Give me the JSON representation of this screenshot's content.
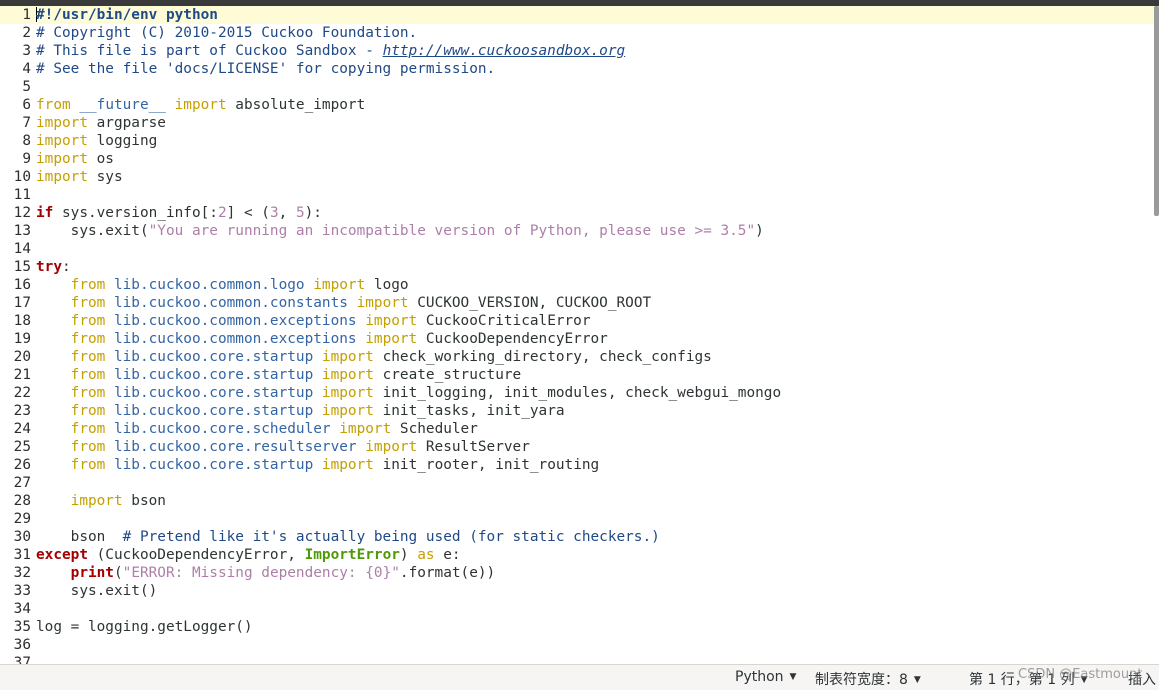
{
  "editor": {
    "lines": [
      {
        "n": "1",
        "tokens": [
          {
            "t": "#!/usr/bin/env python",
            "c": "shebang"
          }
        ]
      },
      {
        "n": "2",
        "tokens": [
          {
            "t": "# Copyright (C) 2010-2015 Cuckoo Foundation.",
            "c": "com"
          }
        ]
      },
      {
        "n": "3",
        "tokens": [
          {
            "t": "# This file is part of Cuckoo Sandbox - ",
            "c": "com"
          },
          {
            "t": "http://www.cuckoosandbox.org",
            "c": "com link"
          }
        ]
      },
      {
        "n": "4",
        "tokens": [
          {
            "t": "# See the file 'docs/LICENSE' for copying permission.",
            "c": "com"
          }
        ]
      },
      {
        "n": "5",
        "tokens": []
      },
      {
        "n": "6",
        "tokens": [
          {
            "t": "from ",
            "c": "kw"
          },
          {
            "t": "__future__",
            "c": "mod"
          },
          {
            "t": " import",
            "c": "kw"
          },
          {
            "t": " absolute_import",
            "c": ""
          }
        ]
      },
      {
        "n": "7",
        "tokens": [
          {
            "t": "import",
            "c": "kw"
          },
          {
            "t": " argparse",
            "c": ""
          }
        ]
      },
      {
        "n": "8",
        "tokens": [
          {
            "t": "import",
            "c": "kw"
          },
          {
            "t": " logging",
            "c": ""
          }
        ]
      },
      {
        "n": "9",
        "tokens": [
          {
            "t": "import",
            "c": "kw"
          },
          {
            "t": " os",
            "c": ""
          }
        ]
      },
      {
        "n": "10",
        "tokens": [
          {
            "t": "import",
            "c": "kw"
          },
          {
            "t": " sys",
            "c": ""
          }
        ]
      },
      {
        "n": "11",
        "tokens": []
      },
      {
        "n": "12",
        "tokens": [
          {
            "t": "if",
            "c": "kwb"
          },
          {
            "t": " sys.version_info[:",
            "c": ""
          },
          {
            "t": "2",
            "c": "num"
          },
          {
            "t": "] < (",
            "c": ""
          },
          {
            "t": "3",
            "c": "num"
          },
          {
            "t": ", ",
            "c": ""
          },
          {
            "t": "5",
            "c": "num"
          },
          {
            "t": "):",
            "c": ""
          }
        ]
      },
      {
        "n": "13",
        "tokens": [
          {
            "t": "    sys.exit(",
            "c": ""
          },
          {
            "t": "\"You are running an incompatible version of Python, please use >= 3.5\"",
            "c": "str"
          },
          {
            "t": ")",
            "c": ""
          }
        ]
      },
      {
        "n": "14",
        "tokens": []
      },
      {
        "n": "15",
        "tokens": [
          {
            "t": "try",
            "c": "kwb"
          },
          {
            "t": ":",
            "c": ""
          }
        ]
      },
      {
        "n": "16",
        "tokens": [
          {
            "t": "    from ",
            "c": "kw"
          },
          {
            "t": "lib.cuckoo.common.logo",
            "c": "mod"
          },
          {
            "t": " import",
            "c": "kw"
          },
          {
            "t": " logo",
            "c": ""
          }
        ]
      },
      {
        "n": "17",
        "tokens": [
          {
            "t": "    from ",
            "c": "kw"
          },
          {
            "t": "lib.cuckoo.common.constants",
            "c": "mod"
          },
          {
            "t": " import",
            "c": "kw"
          },
          {
            "t": " CUCKOO_VERSION, CUCKOO_ROOT",
            "c": ""
          }
        ]
      },
      {
        "n": "18",
        "tokens": [
          {
            "t": "    from ",
            "c": "kw"
          },
          {
            "t": "lib.cuckoo.common.exceptions",
            "c": "mod"
          },
          {
            "t": " import",
            "c": "kw"
          },
          {
            "t": " CuckooCriticalError",
            "c": ""
          }
        ]
      },
      {
        "n": "19",
        "tokens": [
          {
            "t": "    from ",
            "c": "kw"
          },
          {
            "t": "lib.cuckoo.common.exceptions",
            "c": "mod"
          },
          {
            "t": " import",
            "c": "kw"
          },
          {
            "t": " CuckooDependencyError",
            "c": ""
          }
        ]
      },
      {
        "n": "20",
        "tokens": [
          {
            "t": "    from ",
            "c": "kw"
          },
          {
            "t": "lib.cuckoo.core.startup",
            "c": "mod"
          },
          {
            "t": " import",
            "c": "kw"
          },
          {
            "t": " check_working_directory, check_configs",
            "c": ""
          }
        ]
      },
      {
        "n": "21",
        "tokens": [
          {
            "t": "    from ",
            "c": "kw"
          },
          {
            "t": "lib.cuckoo.core.startup",
            "c": "mod"
          },
          {
            "t": " import",
            "c": "kw"
          },
          {
            "t": " create_structure",
            "c": ""
          }
        ]
      },
      {
        "n": "22",
        "tokens": [
          {
            "t": "    from ",
            "c": "kw"
          },
          {
            "t": "lib.cuckoo.core.startup",
            "c": "mod"
          },
          {
            "t": " import",
            "c": "kw"
          },
          {
            "t": " init_logging, init_modules, check_webgui_mongo",
            "c": ""
          }
        ]
      },
      {
        "n": "23",
        "tokens": [
          {
            "t": "    from ",
            "c": "kw"
          },
          {
            "t": "lib.cuckoo.core.startup",
            "c": "mod"
          },
          {
            "t": " import",
            "c": "kw"
          },
          {
            "t": " init_tasks, init_yara",
            "c": ""
          }
        ]
      },
      {
        "n": "24",
        "tokens": [
          {
            "t": "    from ",
            "c": "kw"
          },
          {
            "t": "lib.cuckoo.core.scheduler",
            "c": "mod"
          },
          {
            "t": " import",
            "c": "kw"
          },
          {
            "t": " Scheduler",
            "c": ""
          }
        ]
      },
      {
        "n": "25",
        "tokens": [
          {
            "t": "    from ",
            "c": "kw"
          },
          {
            "t": "lib.cuckoo.core.resultserver",
            "c": "mod"
          },
          {
            "t": " import",
            "c": "kw"
          },
          {
            "t": " ResultServer",
            "c": ""
          }
        ]
      },
      {
        "n": "26",
        "tokens": [
          {
            "t": "    from ",
            "c": "kw"
          },
          {
            "t": "lib.cuckoo.core.startup",
            "c": "mod"
          },
          {
            "t": " import",
            "c": "kw"
          },
          {
            "t": " init_rooter, init_routing",
            "c": ""
          }
        ]
      },
      {
        "n": "27",
        "tokens": []
      },
      {
        "n": "28",
        "tokens": [
          {
            "t": "    import",
            "c": "kw"
          },
          {
            "t": " bson",
            "c": ""
          }
        ]
      },
      {
        "n": "29",
        "tokens": []
      },
      {
        "n": "30",
        "tokens": [
          {
            "t": "    bson  ",
            "c": ""
          },
          {
            "t": "# Pretend like it's actually being used (for static checkers.)",
            "c": "com"
          }
        ]
      },
      {
        "n": "31",
        "tokens": [
          {
            "t": "except",
            "c": "kwb"
          },
          {
            "t": " (CuckooDependencyError, ",
            "c": ""
          },
          {
            "t": "ImportError",
            "c": "exc"
          },
          {
            "t": ") ",
            "c": ""
          },
          {
            "t": "as",
            "c": "kw"
          },
          {
            "t": " e:",
            "c": ""
          }
        ]
      },
      {
        "n": "32",
        "tokens": [
          {
            "t": "    ",
            "c": ""
          },
          {
            "t": "print",
            "c": "kwb"
          },
          {
            "t": "(",
            "c": ""
          },
          {
            "t": "\"ERROR: Missing dependency: {0}\"",
            "c": "str"
          },
          {
            "t": ".format(e))",
            "c": ""
          }
        ]
      },
      {
        "n": "33",
        "tokens": [
          {
            "t": "    sys.exit()",
            "c": ""
          }
        ]
      },
      {
        "n": "34",
        "tokens": []
      },
      {
        "n": "35",
        "tokens": [
          {
            "t": "log = logging.getLogger()",
            "c": ""
          }
        ]
      },
      {
        "n": "36",
        "tokens": []
      },
      {
        "n": "37",
        "tokens": []
      }
    ]
  },
  "statusbar": {
    "language": "Python",
    "tab_width": "制表符宽度：8",
    "position": "第 1 行，第 1 列",
    "mode": "插入",
    "watermark": "CSDN @Eastmount"
  }
}
